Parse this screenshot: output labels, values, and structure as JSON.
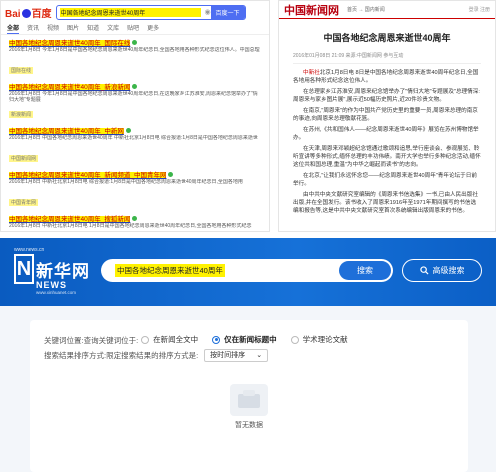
{
  "baidu": {
    "logo_text": "Bai",
    "logo_text2": "百度",
    "query": "中国各地纪念周恩来逝世40周年",
    "search_label": "百度一下",
    "tabs": [
      "全部",
      "资讯",
      "视频",
      "图片",
      "知道",
      "文库",
      "贴吧",
      "更多"
    ],
    "results": [
      {
        "title": "中国各地纪念周恩来逝世40周年_国际在线",
        "abstract": "2016年1月8日 今年1月8日是中国各地纪念周恩来逝世40周年纪念日,全国各地用各种形式纪念这位伟人。中国总理",
        "source": "国际在线"
      },
      {
        "title": "中国各地纪念周恩来逝世40周年_新浪新闻",
        "abstract": "2016年1月8日 今年1月8日是中国各地纪念周恩来逝世40周年纪念日,在这晚家乡江苏淮安,周恩来纪念馆举办了\"情归大地\"专题展",
        "source": "新浪新闻"
      },
      {
        "title": "中国各地纪念周恩来逝世40周年_中新网",
        "abstract": "2016年1月8日 中国各地纪念周恩来逝世40周年 中新社北京1月8日电 综合报道:1月8日是中国各地纪念周恩来逝世",
        "source": "中国新闻网"
      },
      {
        "title": "中国各地纪念周恩来逝世40周年_新闻频道_中国青年网",
        "abstract": "2016年1月8日 中新社北京1月8日电 综合报道:1月8日是中国各地纪念周恩来逝世40周年纪念日,全国各地用",
        "source": "中国青年网"
      },
      {
        "title": "中国各地纪念周恩来逝世40周年_搜狐新闻",
        "abstract": "2016年1月8日 中新社北京1月8日电 1月8日是中国各地纪念周恩来逝世40周年纪念日,全国各地用各种形式纪念",
        "source": "搜狐"
      },
      {
        "title": "纪念周恩来逝世40周年:他们一生忧民来过",
        "abstract": "2016年1月8日 1956年3月在周恩来逝世40周年之际,中共中央文献研究室 1954年,周恩来出席日内瓦会议",
        "source": "搜狐"
      }
    ]
  },
  "chinanews": {
    "logo": "中国新闻网",
    "crumb": "首页 → 国内新闻",
    "account": "登录 注册",
    "title": "中国各地纪念周恩来逝世40周年",
    "meta": "2016年01月08日 21:09  来源:中国新闻网  参与互动",
    "paragraphs": [
      {
        "lead": "中新社",
        "text": "北京1月8日电 8日是中国各地纪念周恩来逝世40周年纪念日,全国各地用各种形式纪念这位伟人。"
      },
      {
        "lead": "",
        "text": "在总理家乡江苏淮安,周恩来纪念馆举办了\"情归大地\"专题展及\"总理情深:周恩来与家乡图片展\",展示近50幅历史照片,近20件珍贵文物。"
      },
      {
        "lead": "",
        "text": "在南京,\"周恩来\"的作为中国共产党历史里的重要一员,周恩来总理的南京的事迹,向周恩来总理敬献花篮。"
      },
      {
        "lead": "",
        "text": "在苏州,《共和国伟人——纪念周恩来逝世40周年》展览在苏州博物馆举办。"
      },
      {
        "lead": "",
        "text": "在天津,周恩来邓颖超纪念馆通过歌颂和追思,举行座谈会、参观展览、聆听宣讲等多种形式,缅怀总理的丰功伟绩。南开大学也举行多种纪念活动,缅怀这位共和国总理,重温\"为中华之崛起而读书\"的志向。"
      },
      {
        "lead": "",
        "text": "在北京,\"让我们永远怀念您——纪念周恩来逝世40周年\"青年论坛于日前举行。"
      },
      {
        "lead": "",
        "text": "由中共中央文献研究室编辑的《周恩来书信选集》一书,已由人民出版社出版,并在全国发行。该书收入了周恩来1916年至1971年期间撰写的书信选编和报告等,这是中共中央文献研究室首次系统编辑出版周恩来的书信。"
      }
    ]
  },
  "xinhua": {
    "url_top": "www.news.cn",
    "logo_n": "N",
    "logo_cn": "新华网",
    "logo_sub": "NEWS",
    "url_bottom": "www.xinhuanet.com",
    "query": "中国各地纪念周恩来逝世40周年",
    "search_button": "搜索",
    "advanced_label": "高级搜索",
    "scope_label": "关键词位置:查询关键词位于:",
    "scope_options": [
      "在新闻全文中",
      "仅在新闻标题中",
      "学术理论文献"
    ],
    "scope_selected": 1,
    "sort_label": "搜索结果排序方式:限定搜索结果的排序方式是:",
    "sort_value": "按时间排序",
    "empty_text": "暂无数据"
  },
  "colors": {
    "highlight": "#fff200",
    "baidu_blue": "#4e6ef2",
    "xinhua_blue": "#1671d8",
    "chinanews_red": "#b8000f"
  }
}
